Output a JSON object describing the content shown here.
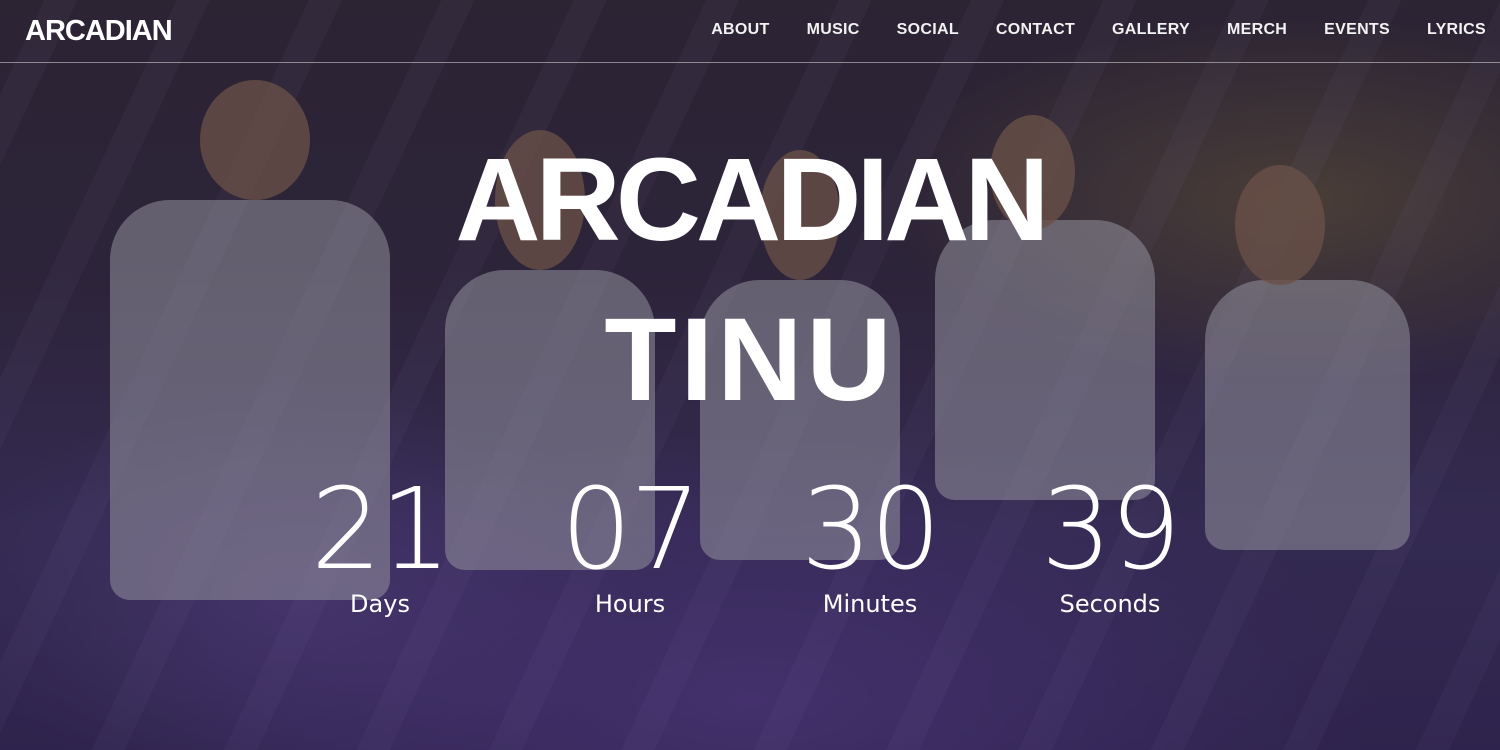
{
  "header": {
    "logo_text": "ARCADIAN",
    "nav": [
      "ABOUT",
      "MUSIC",
      "SOCIAL",
      "CONTACT",
      "GALLERY",
      "MERCH",
      "EVENTS",
      "LYRICS"
    ]
  },
  "hero": {
    "logo_text": "ARCADIAN",
    "title": "TINU"
  },
  "countdown": {
    "days": {
      "value": "21",
      "label": "Days"
    },
    "hours": {
      "value": "07",
      "label": "Hours"
    },
    "minutes": {
      "value": "30",
      "label": "Minutes"
    },
    "seconds": {
      "value": "39",
      "label": "Seconds"
    }
  },
  "colors": {
    "background_tint": "#3c2f66",
    "text": "#ffffff"
  }
}
